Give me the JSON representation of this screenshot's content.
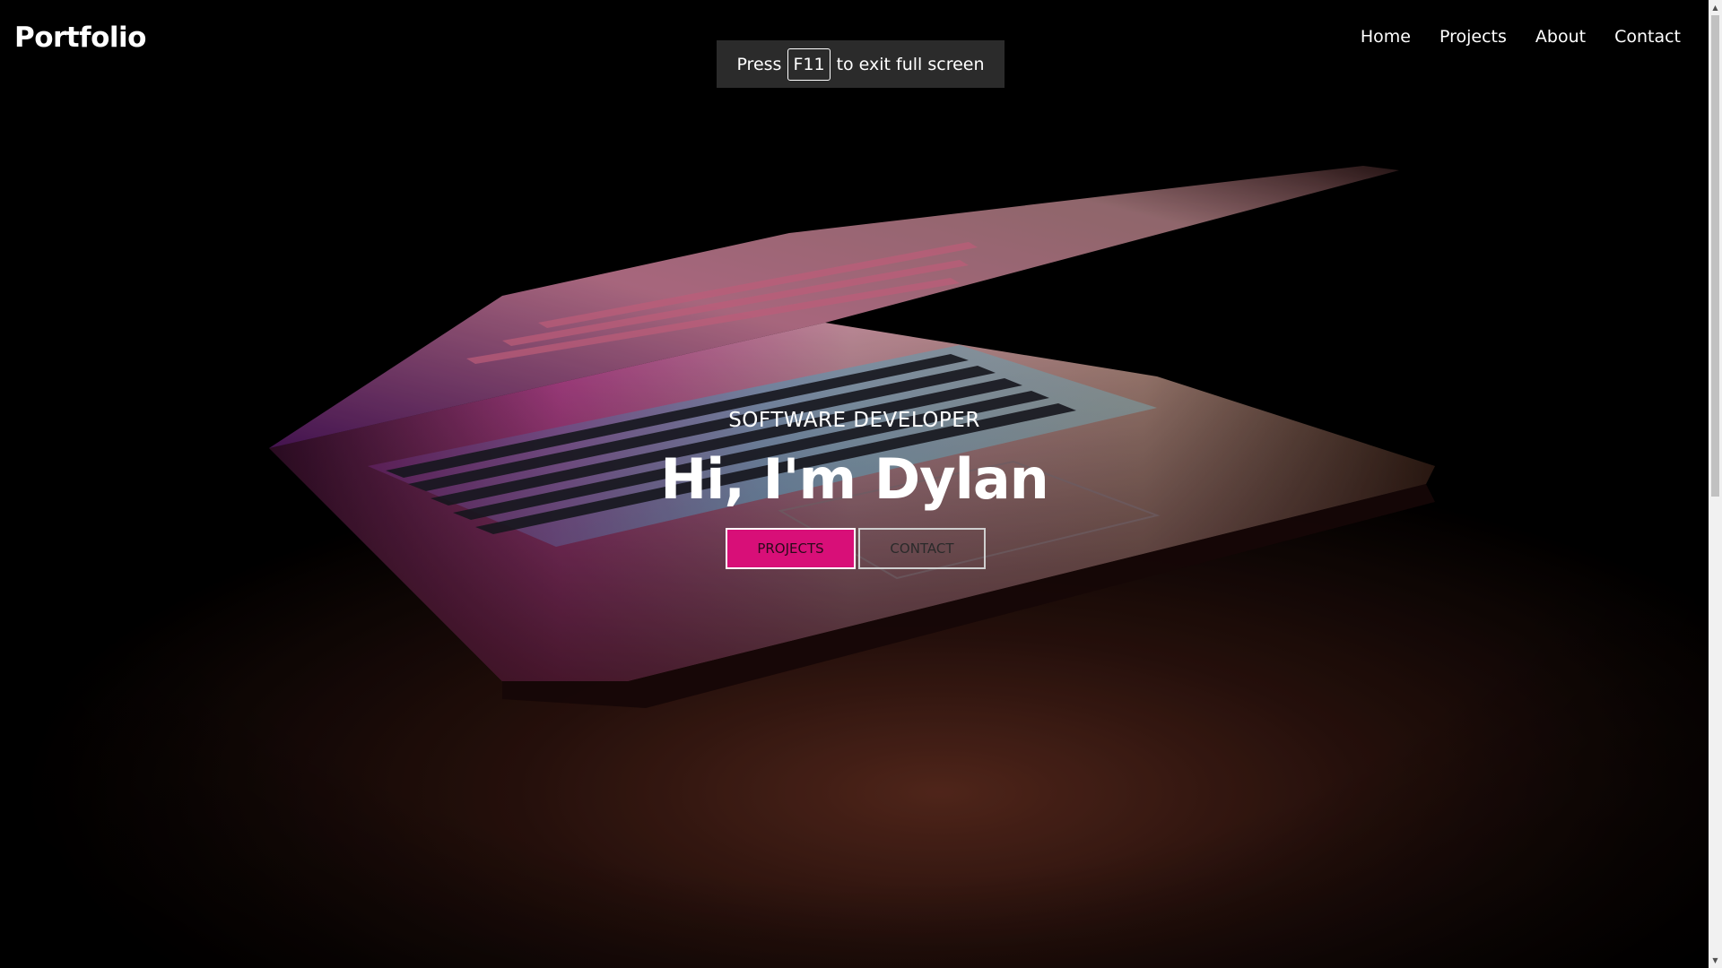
{
  "brand": "Portfolio",
  "nav": {
    "home": "Home",
    "projects": "Projects",
    "about": "About",
    "contact": "Contact"
  },
  "fullscreen_toast": {
    "prefix": "Press",
    "key": "F11",
    "suffix": "to exit full screen"
  },
  "hero": {
    "subtitle": "SOFTWARE DEVELOPER",
    "title": "Hi, I'm Dylan",
    "primary_button": "PROJECTS",
    "secondary_button": "CONTACT"
  },
  "colors": {
    "accent": "#d80f78",
    "background": "#000000",
    "toast_bg": "#2b2b2b"
  },
  "icons": {
    "scroll_up": "triangle-up-icon",
    "scroll_down": "triangle-down-icon"
  }
}
